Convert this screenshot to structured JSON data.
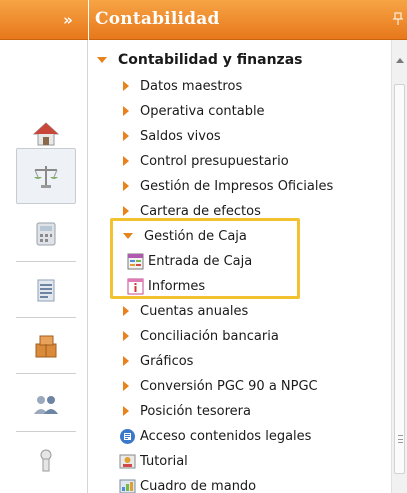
{
  "strip": {
    "collapse_label": "»",
    "items": [
      {
        "icon": "home-icon"
      },
      {
        "icon": "balance-scale-icon",
        "active": true
      },
      {
        "icon": "calculator-icon"
      },
      {
        "icon": "ledger-book-icon"
      },
      {
        "icon": "boxes-icon"
      },
      {
        "icon": "users-icon"
      },
      {
        "icon": "keyhole-icon"
      }
    ]
  },
  "panel": {
    "title": "Contabilidad",
    "pin_icon": "pin-icon"
  },
  "tree": {
    "root": "Contabilidad y finanzas",
    "items": [
      "Datos maestros",
      "Operativa contable",
      "Saldos vivos",
      "Control presupuestario",
      "Gestión de Impresos Oficiales",
      "Cartera de efectos",
      "Gestión de Caja",
      "Entrada de Caja",
      "Informes",
      "Cuentas anuales",
      "Conciliación bancaria",
      "Gráficos",
      "Conversión PGC 90 a NPGC",
      "Posición tesorera",
      "Acceso contenidos legales",
      "Tutorial",
      "Cuadro de mando"
    ]
  },
  "colors": {
    "header_orange": "#e7781b",
    "arrow_orange": "#e8821c",
    "highlight_yellow": "#f2c230"
  }
}
